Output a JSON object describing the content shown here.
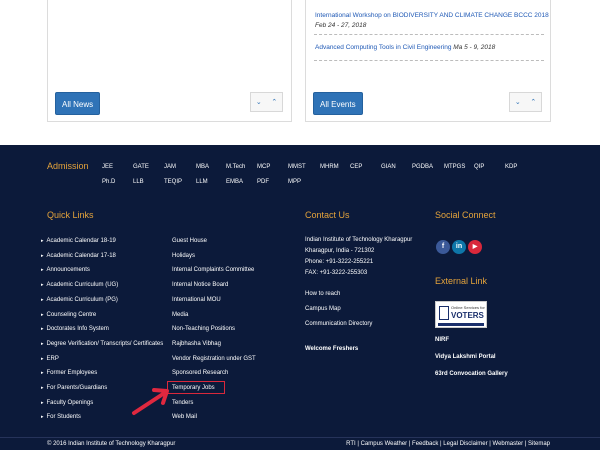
{
  "news_card": {
    "all_label": "All News"
  },
  "events_card": {
    "events": [
      {
        "title": "International Workshop on BIODIVERSITY AND CLIMATE CHANGE BCCC 2018",
        "date": "Feb 24 - 27, 2018"
      },
      {
        "title": "Advanced Computing Tools in Civil Engineering",
        "date": "Ma 5 - 9, 2018"
      }
    ],
    "all_label": "All Events"
  },
  "nav_arrows": {
    "down": "⌄",
    "up": "⌃"
  },
  "admission": {
    "title": "Admission",
    "row1": [
      "JEE",
      "GATE",
      "JAM",
      "MBA",
      "M.Tech",
      "MCP",
      "MMST",
      "MHRM",
      "CEP",
      "GIAN",
      "PGDBA",
      "MTPGS",
      "QIP",
      "KDP"
    ],
    "row2": [
      "Ph.D",
      "LLB",
      "TEQIP",
      "LLM",
      "EMBA",
      "PDF",
      "MPP"
    ]
  },
  "quick_links": {
    "title": "Quick Links",
    "col1": [
      "Academic Calendar 18-19",
      "Academic Calendar 17-18",
      "Announcements",
      "Academic Curriculum (UG)",
      "Academic Curriculum (PG)",
      "Counseling Centre",
      "Doctorates Info System",
      "Degree Verification/ Transcripts/ Certificates",
      "ERP",
      "Former Employees",
      "For Parents/Guardians",
      "Faculty Openings",
      "For Students"
    ],
    "col2": [
      "Guest House",
      "Holidays",
      "Internal Complaints Committee",
      "Internal Notice Board",
      "International MOU",
      "Media",
      "Non-Teaching Positions",
      "Rajbhasha Vibhag",
      "Vendor Registration under GST",
      "Sponsored Research",
      "Temporary Jobs",
      "Tenders",
      "Web Mail"
    ]
  },
  "contact": {
    "title": "Contact Us",
    "address": [
      "Indian Institute of Technology Kharagpur",
      "Kharagpur, India - 721302",
      "Phone: +91-3222-255221",
      "FAX: +91-3222-255303"
    ],
    "links": [
      "How to reach",
      "Campus Map",
      "Communication Directory"
    ],
    "welcome": "Welcome Freshers"
  },
  "social": {
    "title": "Social Connect",
    "icons": [
      {
        "name": "facebook-icon",
        "glyph": "f",
        "color": "#3b5998"
      },
      {
        "name": "linkedin-icon",
        "glyph": "in",
        "color": "#0e76a8"
      },
      {
        "name": "youtube-icon",
        "glyph": "▶",
        "color": "#d9283b"
      }
    ]
  },
  "external": {
    "title": "External Link",
    "voters_top": "Online Services for",
    "voters_main": "VOTERS",
    "links": [
      "NIRF",
      "Vidya Lakshmi Portal",
      "63rd Convocation Gallery"
    ]
  },
  "footer": {
    "copyright": "© 2016 Indian Institute of Technology Kharagpur",
    "links": "RTI | Campus Weather | Feedback | Legal Disclaimer | Webmaster | Sitemap"
  }
}
